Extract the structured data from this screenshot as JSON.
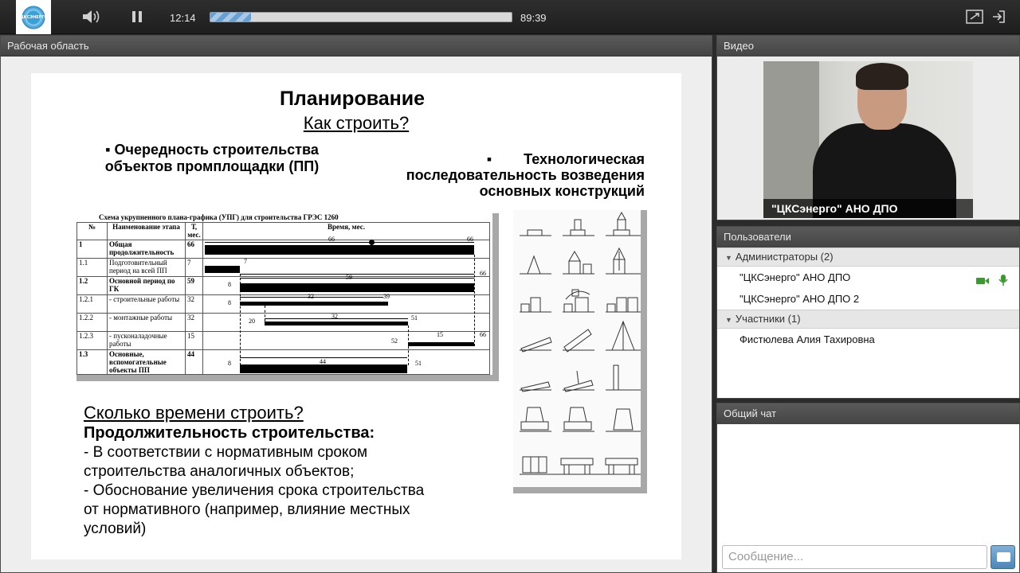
{
  "player": {
    "current_time": "12:14",
    "total_time": "89:39",
    "progress_percent": 13.6,
    "logo_text": "ЦКСЭНЕРГО"
  },
  "workarea": {
    "title": "Рабочая область",
    "slide": {
      "title": "Планирование",
      "subtitle": "Как строить?",
      "bullet1": "▪ Очередность строительства объектов промплощадки (ПП)",
      "bullet2": "▪        Технологическая последовательность возведения основных конструкций",
      "gantt": {
        "title": "Схема укрупненного плана-графика (УПГ) для строительства ГРЭС 1260",
        "headers": [
          "№",
          "Наименование этапа",
          "Т, мес.",
          "Время, мес."
        ],
        "rows": [
          {
            "num": "1",
            "name": "Общая продолжительность",
            "t": "66",
            "bold": true
          },
          {
            "num": "1.1",
            "name": "Подготовительный период на всей ПП",
            "t": "7",
            "bold": false
          },
          {
            "num": "1.2",
            "name": "Основной период по ГК",
            "t": "59",
            "bold": true
          },
          {
            "num": "1.2.1",
            "name": "- строительные работы",
            "t": "32",
            "bold": false
          },
          {
            "num": "1.2.2",
            "name": "- монтажные работы",
            "t": "32",
            "bold": false
          },
          {
            "num": "1.2.3",
            "name": "- пусконаладочные работы",
            "t": "15",
            "bold": false
          },
          {
            "num": "1.3",
            "name": "Основные, вспомогательные объекты ПП",
            "t": "44",
            "bold": true
          }
        ],
        "labels": {
          "l66a": "66",
          "l66b": "66",
          "l7": "7",
          "l66c": "66",
          "l8a": "8",
          "l59": "59",
          "l8b": "8",
          "l32a": "32",
          "l39": "39",
          "l20": "20",
          "l32b": "32",
          "l51a": "51",
          "l15": "15",
          "l66d": "66",
          "l52": "52",
          "l8c": "8",
          "l44": "44",
          "l51b": "51"
        }
      },
      "question": "Сколько времени строить?",
      "heading": "Продолжительность строительства:",
      "lines": [
        "- В соответствии с нормативным сроком",
        "строительства аналогичных объектов;",
        "- Обоснование увеличения срока строительства",
        "от нормативного (например, влияние местных",
        "условий)"
      ]
    }
  },
  "video": {
    "title": "Видео",
    "label": "\"ЦКСэнерго\" АНО ДПО"
  },
  "users": {
    "title": "Пользователи",
    "admins_label": "Администраторы (2)",
    "admins": [
      "\"ЦКСэнерго\" АНО ДПО",
      "\"ЦКСэнерго\" АНО ДПО 2"
    ],
    "participants_label": "Участники (1)",
    "participants": [
      "Фистюлева Алия Тахировна"
    ]
  },
  "chat": {
    "title": "Общий чат",
    "placeholder": "Сообщение..."
  }
}
